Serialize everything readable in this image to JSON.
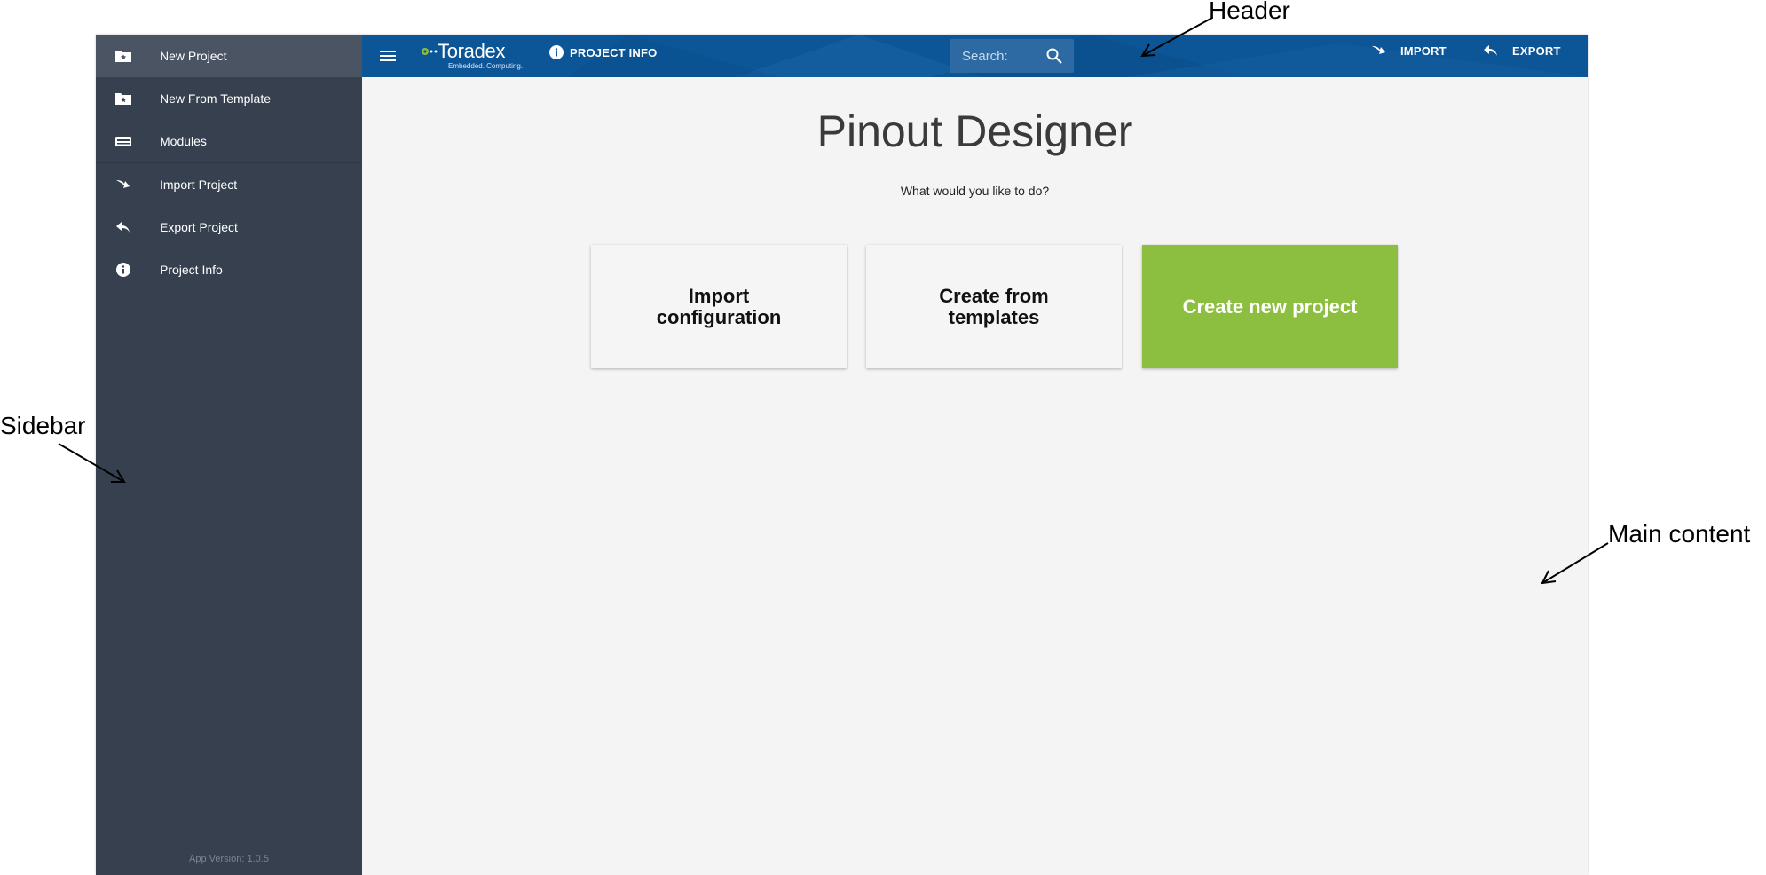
{
  "sidebar": {
    "items": [
      {
        "label": "New Project",
        "icon": "folder-star-icon"
      },
      {
        "label": "New From Template",
        "icon": "folder-star-icon"
      },
      {
        "label": "Modules",
        "icon": "module-icon"
      },
      {
        "label": "Import Project",
        "icon": "import-arrow-icon"
      },
      {
        "label": "Export Project",
        "icon": "reply-arrow-icon"
      },
      {
        "label": "Project Info",
        "icon": "info-icon"
      }
    ],
    "app_version": "App Version: 1.0.5"
  },
  "header": {
    "logo_text": "Toradex",
    "logo_tagline": "Embedded. Computing.",
    "project_info_label": "PROJECT INFO",
    "search_placeholder": "Search:",
    "import_label": "IMPORT",
    "export_label": "EXPORT"
  },
  "main": {
    "title": "Pinout Designer",
    "subtitle": "What would you like to do?",
    "cards": [
      {
        "label": "Import configuration"
      },
      {
        "label": "Create from templates"
      },
      {
        "label": "Create new project"
      }
    ]
  },
  "annotations": {
    "header": "Header",
    "sidebar": "Sidebar",
    "main_content": "Main content"
  },
  "colors": {
    "sidebar_bg": "#36404e",
    "header_bg": "#0c5596",
    "accent_green": "#8cbf3f",
    "main_bg": "#f4f4f4"
  }
}
